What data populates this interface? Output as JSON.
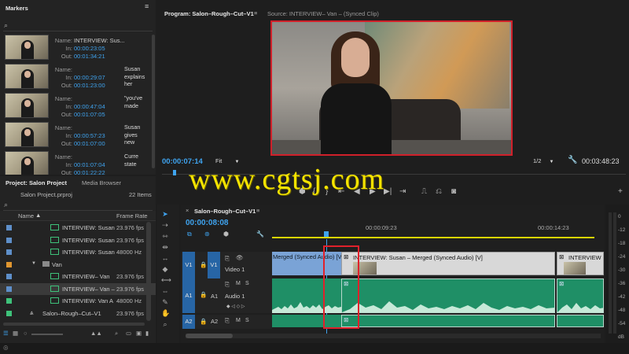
{
  "markers_panel": {
    "title": "Markers",
    "search_icon": "search-icon",
    "items": [
      {
        "name_label": "Name:",
        "name": "INTERVIEW: Sus...",
        "in_label": "In:",
        "in": "00:00:23:05",
        "out_label": "Out:",
        "out": "00:01:34:21",
        "comment": ""
      },
      {
        "name_label": "Name:",
        "name": "",
        "in_label": "In:",
        "in": "00:00:29:07",
        "out_label": "Out:",
        "out": "00:01:23:00",
        "comment": "Susan explains her"
      },
      {
        "name_label": "Name:",
        "name": "",
        "in_label": "In:",
        "in": "00:00:47:04",
        "out_label": "Out:",
        "out": "00:01:07:05",
        "comment": "\"you've made"
      },
      {
        "name_label": "Name:",
        "name": "",
        "in_label": "In:",
        "in": "00:00:57:23",
        "out_label": "Out:",
        "out": "00:01:07:00",
        "comment": "Susan gives new"
      },
      {
        "name_label": "Name:",
        "name": "",
        "in_label": "In:",
        "in": "00:01:07:04",
        "out_label": "Out:",
        "out": "00:01:22:22",
        "comment": "Curre state"
      }
    ]
  },
  "project_panel": {
    "tab_project": "Project: Salon Project",
    "tab_media": "Media Browser",
    "file": "Salon Project.prproj",
    "count": "22 Items",
    "col_name": "Name",
    "col_rate": "Frame Rate",
    "rows": [
      {
        "name": "INTERVIEW: Susan",
        "rate": "23.976 fps",
        "color": "#5e8fc9",
        "indent": 1,
        "kind": "clip"
      },
      {
        "name": "INTERVIEW: Susan",
        "rate": "23.976 fps",
        "color": "#5e8fc9",
        "indent": 1,
        "kind": "clip"
      },
      {
        "name": "INTERVIEW: Susan",
        "rate": "48000 Hz",
        "color": "#5e8fc9",
        "indent": 1,
        "kind": "clip"
      },
      {
        "name": "Van",
        "rate": "",
        "color": "#e0962f",
        "indent": 0,
        "kind": "folder"
      },
      {
        "name": "INTERVIEW– Van",
        "rate": "23.976 fps",
        "color": "#5e8fc9",
        "indent": 1,
        "kind": "clip"
      },
      {
        "name": "INTERVIEW– Van –",
        "rate": "23.976 fps",
        "color": "#5e8fc9",
        "indent": 1,
        "kind": "clip"
      },
      {
        "name": "INTERVIEW: Van A",
        "rate": "48000 Hz",
        "color": "#3ec27a",
        "indent": 1,
        "kind": "clip"
      },
      {
        "name": "Salon–Rough–Cut–V1",
        "rate": "23.976 fps",
        "color": "#3ec27a",
        "indent": 0,
        "kind": "sequence"
      }
    ]
  },
  "program_monitor": {
    "tab_program": "Program: Salon–Rough–Cut–V1",
    "tab_source": "Source: INTERVIEW– Van – (Synced Clip)",
    "timecode": "00:00:07:14",
    "fit": "Fit",
    "resolution": "1/2",
    "duration": "00:03:48:23"
  },
  "watermark": "www.cgtsj.com",
  "timeline": {
    "tab": "Salon–Rough–Cut–V1",
    "timecode": "00:00:08:08",
    "ruler": [
      "00:00:09:23",
      "00:00:14:23"
    ],
    "tracks": {
      "v1_patch": "V1",
      "v1": "V1",
      "v1_name": "Video 1",
      "a1_patch": "A1",
      "a1": "A1",
      "a1_name": "Audio 1",
      "a2_patch": "A2",
      "a2": "A2"
    },
    "track_buttons": {
      "m": "M",
      "s": "S"
    },
    "clips": {
      "clip1": "Merged (Synced Audio) [V]",
      "clip2": "INTERVIEW: Susan – Merged (Synced Audio) [V]",
      "clip3": "INTERVIEW"
    },
    "meter_labels": [
      "0",
      "-12",
      "-18",
      "-24",
      "-30",
      "-36",
      "-42",
      "-48",
      "-54",
      "dB"
    ]
  },
  "colors": {
    "accent": "#3fa4f0",
    "video_clip": "#7aa3d6",
    "audio_clip": "#1f8f66",
    "highlight": "#e0212b",
    "watermark": "#f5e400"
  }
}
